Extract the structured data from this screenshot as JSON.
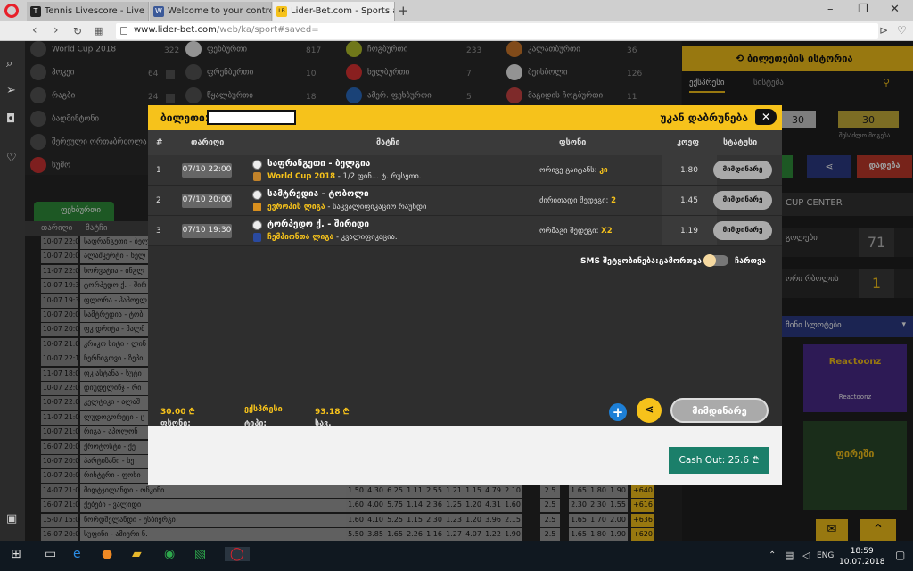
{
  "browser": {
    "tabs": [
      {
        "title": "Tennis Livescore - Live Sco",
        "fav_color": "#222222",
        "fav": "T"
      },
      {
        "title": "Welcome to your control p",
        "fav_color": "#3b5998",
        "fav": "W"
      },
      {
        "title": "Lider-Bet.com - Sports and",
        "fav_color": "#f6c21b",
        "fav": "LB"
      }
    ],
    "url_host": "www.lider-bet.com",
    "url_path": "/web/ka/sport#saved="
  },
  "background": {
    "sports": [
      {
        "label": "World Cup 2018",
        "count": "322"
      },
      {
        "label": "ჰოკეი",
        "count": "64"
      },
      {
        "label": "რაგბი",
        "count": "24"
      },
      {
        "label": "ბადმინტონი",
        "count": ""
      },
      {
        "label": "შერეული ორთაბრძოლა",
        "count": ""
      },
      {
        "label": "სუმო",
        "count": ""
      }
    ],
    "sports_col2": [
      {
        "label": "ფეხბურთი",
        "count": "817"
      },
      {
        "label": "ფრენბურთი",
        "count": "10"
      },
      {
        "label": "წყალბურთი",
        "count": "18"
      }
    ],
    "sports_col3": [
      {
        "label": "ჩოგბურთი",
        "count": "233"
      },
      {
        "label": "ხელბურთი",
        "count": "7"
      },
      {
        "label": "ამერ. ფეხბურთი",
        "count": "5"
      }
    ],
    "sports_col4": [
      {
        "label": "კალათბურთი",
        "count": "36"
      },
      {
        "label": "ბეისბოლი",
        "count": "126"
      },
      {
        "label": "მაგიდის ჩოგბურთი",
        "count": "11"
      }
    ],
    "tab_football": "ფეხბურთი",
    "col_headers": [
      "თარიღი",
      "მატჩი"
    ],
    "rows": [
      {
        "date": "10-07 22:00",
        "name": "საფრანგეთი - ბელ"
      },
      {
        "date": "10-07 20:00",
        "name": "ალაშკერტი - ხელ"
      },
      {
        "date": "11-07 22:00",
        "name": "ხორვატია - ინგლ"
      },
      {
        "date": "10-07 19:30",
        "name": "ტორპედო ქ. - შირ"
      },
      {
        "date": "10-07 19:30",
        "name": "ფლორა - ჰაპოელ"
      },
      {
        "date": "10-07 20:00",
        "name": "სამტრედია - ტობ"
      },
      {
        "date": "10-07 20:00",
        "name": "ფკ დრიტა - მალმ"
      },
      {
        "date": "10-07 21:00",
        "name": "კრაკო სიტი - ლინ"
      },
      {
        "date": "10-07 22:15",
        "name": "ჩერნიგოვი - ზეპი"
      },
      {
        "date": "11-07 18:00",
        "name": "ფკ ასტანა - სუტი"
      },
      {
        "date": "10-07 22:00",
        "name": "დიუდელინჯ - რი"
      },
      {
        "date": "10-07 22:00",
        "name": "კელტიკი - ალაშ"
      },
      {
        "date": "11-07 21:00",
        "name": "ლუდოგორეცი - ც"
      },
      {
        "date": "10-07 21:00",
        "name": "რიგა - აპოლონ"
      },
      {
        "date": "16-07 20:00",
        "name": "ქროტოსტი - ქე"
      },
      {
        "date": "10-07 20:00",
        "name": "პარტიზანი - ხე"
      },
      {
        "date": "10-07 20:00",
        "name": "რიხტერი - ფოხი"
      },
      {
        "date": "14-07 21:00",
        "name": "მიდტჯილანდი - ოჩკინი"
      },
      {
        "date": "16-07 21:00",
        "name": "ქებები - ვალიდი"
      },
      {
        "date": "15-07 15:00",
        "name": "ნორდშელანდი - ესბიერგი"
      },
      {
        "date": "16-07 20:00",
        "name": "სუფინი - ამიერი ნ."
      }
    ],
    "odds_rows": [
      [
        "1.50",
        "4.30",
        "6.25",
        "1.11",
        "2.55",
        "1.21",
        "1.15",
        "4.79",
        "2.10",
        "2.5",
        "1.65",
        "1.80",
        "1.90",
        "+640"
      ],
      [
        "1.60",
        "4.00",
        "5.75",
        "1.14",
        "2.36",
        "1.25",
        "1.20",
        "4.31",
        "1.60",
        "2.5",
        "2.30",
        "2.30",
        "1.55",
        "+616"
      ],
      [
        "1.60",
        "4.10",
        "5.25",
        "1.15",
        "2.30",
        "1.23",
        "1.20",
        "3.96",
        "2.15",
        "2.5",
        "1.65",
        "1.70",
        "2.00",
        "+636"
      ],
      [
        "5.50",
        "3.85",
        "1.65",
        "2.26",
        "1.16",
        "1.27",
        "4.07",
        "1.22",
        "1.90",
        "2.5",
        "1.65",
        "1.80",
        "1.90",
        "+620"
      ]
    ],
    "right": {
      "history_title": "ბილეთების ისტორია",
      "tab_express": "ექსპრესი",
      "tab_system": "სისტემა",
      "box_values": [
        "30",
        "30"
      ],
      "box_label": "შესაძლო მოგება",
      "bet_button": "დადება",
      "cup_center": "CUP CENTER",
      "stat1_label": "გოლები",
      "stat1_value": "71",
      "stat2_label": "ორი რბოლის",
      "stat2_value": "1",
      "slots_label": "მინი სლოტები",
      "game1": "Reactoonz",
      "game1_caption": "Reactoonz",
      "game2": "ფირეში"
    }
  },
  "modal": {
    "title_prefix": "ბილეთი:",
    "back_label": "უკან დაბრუნება",
    "headers": {
      "num": "#",
      "date": "თარიღი",
      "match": "მატჩი",
      "bet": "ფსონი",
      "coef": "კოეფ",
      "status": "სტატუსი"
    },
    "rows": [
      {
        "num": "1",
        "date": "07/10 22:00",
        "match": "საფრანგეთი - ბელგია",
        "league": "World Cup 2018",
        "league_rest": " - 1/2 ფინ... ტ. რუსეთი.",
        "bet_label": "ორივე გაიტანს: ",
        "bet_value": "კი",
        "coef": "1.80",
        "status": "მიმდინარე",
        "flag_color": "#c2832a"
      },
      {
        "num": "2",
        "date": "07/10 20:00",
        "match": "სამტრედია - ტობოლი",
        "league": "ევროპის ლიგა",
        "league_rest": " - საკვალიფიკაციო რაუნდი",
        "bet_label": "ძირითადი შედეგი: ",
        "bet_value": "2",
        "coef": "1.45",
        "status": "მიმდინარე",
        "flag_color": "#d88f1e"
      },
      {
        "num": "3",
        "date": "07/10 19:30",
        "match": "ტორპედო ქ. - შირიდი",
        "league": "ჩემპიონთა ლიგა",
        "league_rest": " - კვალიფიკაცია.",
        "bet_label": "ორმაგი შედეგი: ",
        "bet_value": "X2",
        "coef": "1.19",
        "status": "მიმდინარე",
        "flag_color": "#2a4aa0"
      }
    ],
    "sms_label": "SMS შეტყობინება:",
    "sms_on": "გამორთვა",
    "sms_off": "ჩართვა",
    "sms_enabled": false,
    "stake_label": "ფსონი: ",
    "stake_value": "30.00 ₾",
    "type_label": "ტიპი: ",
    "type_value": "ექსპრესი",
    "win_label": "სავ. მოგება: ",
    "win_value": "93.18 ₾",
    "big_status": "მიმდინარე",
    "cashout": "Cash Out: 25.6 ₾"
  },
  "taskbar": {
    "lang": "ENG",
    "time": "18:59",
    "date": "10.07.2018"
  }
}
